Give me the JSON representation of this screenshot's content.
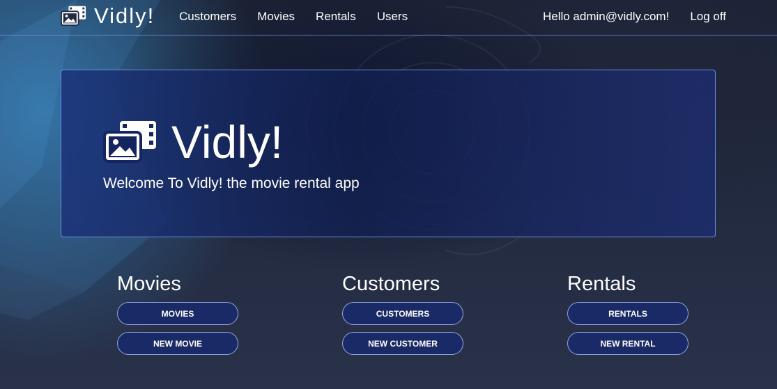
{
  "navbar": {
    "brand": "Vidly!",
    "brand_icon": "photo-film-icon",
    "links": [
      "Customers",
      "Movies",
      "Rentals",
      "Users"
    ],
    "greeting": "Hello admin@vidly.com!",
    "logoff": "Log off"
  },
  "jumbotron": {
    "title": "Vidly!",
    "subtitle": "Welcome To Vidly! the movie rental app"
  },
  "sections": [
    {
      "heading": "Movies",
      "buttons": [
        "MOVIES",
        "NEW MOVIE"
      ]
    },
    {
      "heading": "Customers",
      "buttons": [
        "CUSTOMERS",
        "NEW CUSTOMER"
      ]
    },
    {
      "heading": "Rentals",
      "buttons": [
        "RENTALS",
        "NEW RENTAL"
      ]
    }
  ],
  "colors": {
    "accent_border": "#7896e6",
    "button_fill": "#1a2a66",
    "jumbotron_fill": "#1b3278"
  }
}
